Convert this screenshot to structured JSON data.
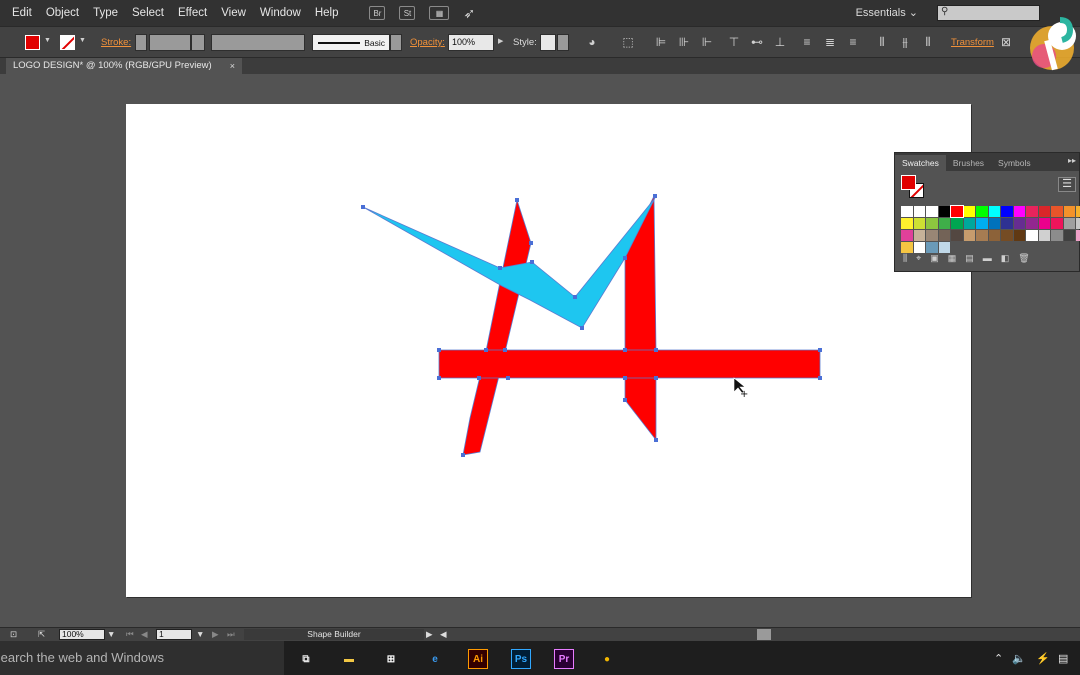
{
  "menu": {
    "items": [
      "Edit",
      "Object",
      "Type",
      "Select",
      "Effect",
      "View",
      "Window",
      "Help"
    ],
    "icon_st": "St",
    "icon_br": "Br",
    "workspace": "Essentials",
    "workspace_arrow": "⌄"
  },
  "control": {
    "stroke_label": "Stroke:",
    "brush_label": "Basic",
    "opacity_label": "Opacity:",
    "opacity_value": "100%",
    "style_label": "Style:",
    "transform_label": "Transform"
  },
  "document": {
    "tab_title": "LOGO DESIGN* @ 100% (RGB/GPU Preview)",
    "close": "×"
  },
  "swatches_panel": {
    "tabs": [
      "Swatches",
      "Brushes",
      "Symbols"
    ],
    "menu_icon": "▸▸",
    "swatch_colors": [
      "#ffffff",
      "#ffffff",
      "#ffffff",
      "#000000",
      "#ff0000",
      "#ffff00",
      "#00ff00",
      "#00ffff",
      "#0000ff",
      "#ff00ff",
      "#e8245c",
      "#d9262a",
      "#e8552a",
      "#f3922b",
      "#f6b12d",
      "#fff22d",
      "#cde033",
      "#8cc63f",
      "#3fae49",
      "#00a551",
      "#00a79d",
      "#00aeef",
      "#0072bc",
      "#2e3192",
      "#662d91",
      "#92278f",
      "#ec008c",
      "#ed145b",
      "#a0a0a0",
      "#c8c8c8",
      "#e0409a",
      "#c7b299",
      "#998675",
      "#736357",
      "#534741",
      "#c69c6d",
      "#a67c52",
      "#8c6239",
      "#754c24",
      "#603913",
      "#ffffff",
      "#d0d0d0",
      "#8c8c8c",
      "#404040",
      "#f0a0c8",
      "#f5c542",
      "#ffffff",
      "#6a9ab8",
      "#c0d8e8"
    ],
    "colors": {
      "fill": "#e10000",
      "accent": "#f0913a"
    }
  },
  "status": {
    "zoom": "100%",
    "artboard_num": "1",
    "tool": "Shape Builder"
  },
  "taskbar": {
    "search_text": "Search the web and Windows",
    "apps": [
      {
        "name": "task-view",
        "label": "⧉",
        "color": "#e6e6e6",
        "bg": "transparent"
      },
      {
        "name": "file-explorer",
        "label": "▬",
        "color": "#f2c744",
        "bg": "transparent"
      },
      {
        "name": "store",
        "label": "⊞",
        "color": "#ffffff",
        "bg": "transparent"
      },
      {
        "name": "edge",
        "label": "e",
        "color": "#3a9bf0",
        "bg": "transparent"
      },
      {
        "name": "illustrator",
        "label": "Ai",
        "color": "#ff9a00",
        "bg": "#330000"
      },
      {
        "name": "photoshop",
        "label": "Ps",
        "color": "#31a8ff",
        "bg": "#001e36"
      },
      {
        "name": "premiere",
        "label": "Pr",
        "color": "#e77cff",
        "bg": "#2a0033"
      },
      {
        "name": "chrome",
        "label": "●",
        "color": "#f2b600",
        "bg": "transparent"
      }
    ],
    "tray": [
      "⌃",
      "🔈",
      "⚡",
      "▤"
    ]
  }
}
